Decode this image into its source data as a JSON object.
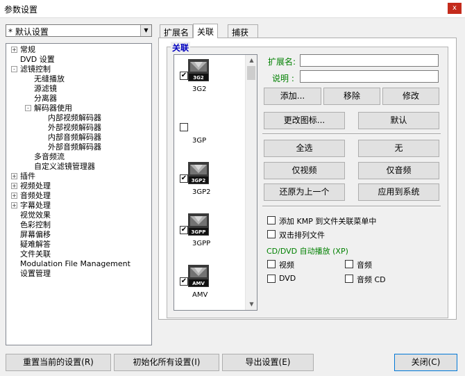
{
  "window": {
    "title": "参数设置",
    "close": "x"
  },
  "profile": {
    "selected": "* 默认设置"
  },
  "tree": [
    {
      "label": "常规",
      "t": "+"
    },
    {
      "label": "DVD 设置"
    },
    {
      "label": "滤镜控制",
      "t": "-"
    },
    {
      "label": "无缝播放"
    },
    {
      "label": "源滤镜"
    },
    {
      "label": "分离器"
    },
    {
      "label": "解码器使用",
      "t": "-"
    },
    {
      "label": "内部视频解码器"
    },
    {
      "label": "外部视频解码器"
    },
    {
      "label": "内部音频解码器"
    },
    {
      "label": "外部音频解码器"
    },
    {
      "label": "多音频流"
    },
    {
      "label": "自定义滤镜管理器"
    },
    {
      "label": "插件",
      "t": "+"
    },
    {
      "label": "视频处理",
      "t": "+"
    },
    {
      "label": "音频处理",
      "t": "+"
    },
    {
      "label": "字幕处理",
      "t": "+"
    },
    {
      "label": "视觉效果"
    },
    {
      "label": "色彩控制"
    },
    {
      "label": "屏幕偏移"
    },
    {
      "label": "疑难解答"
    },
    {
      "label": "文件关联"
    },
    {
      "label": "Modulation File Management"
    },
    {
      "label": "设置管理"
    }
  ],
  "tabs": [
    "扩展名",
    "关联",
    "捕获"
  ],
  "group_label": "关联",
  "filetypes": [
    {
      "name": "3G2",
      "checked": true,
      "badge": "3G2"
    },
    {
      "name": "3GP",
      "checked": false,
      "badge": ""
    },
    {
      "name": "3GP2",
      "checked": true,
      "badge": "3GP2"
    },
    {
      "name": "3GPP",
      "checked": true,
      "badge": "3GPP"
    },
    {
      "name": "AMV",
      "checked": true,
      "badge": "AMV"
    }
  ],
  "form": {
    "ext_label": "扩展名:",
    "desc_label": "说明 :"
  },
  "buttons": {
    "add": "添加...",
    "remove": "移除",
    "edit": "修改",
    "change_icon": "更改图标...",
    "default": "默认",
    "select_all": "全选",
    "none": "无",
    "video_only": "仅视频",
    "audio_only": "仅音频",
    "restore": "还原为上一个",
    "apply": "应用到系统"
  },
  "options": {
    "add_menu": "添加 KMP 到文件关联菜单中",
    "dbl_click": "双击排列文件"
  },
  "autoplay": {
    "label": "CD/DVD 自动播放 (XP)",
    "video": "视频",
    "audio": "音频",
    "dvd": "DVD",
    "audio_cd": "音频 CD"
  },
  "bottom": {
    "reset": "重置当前的设置(R)",
    "init": "初始化所有设置(I)",
    "export": "导出设置(E)",
    "close": "关闭(C)"
  }
}
